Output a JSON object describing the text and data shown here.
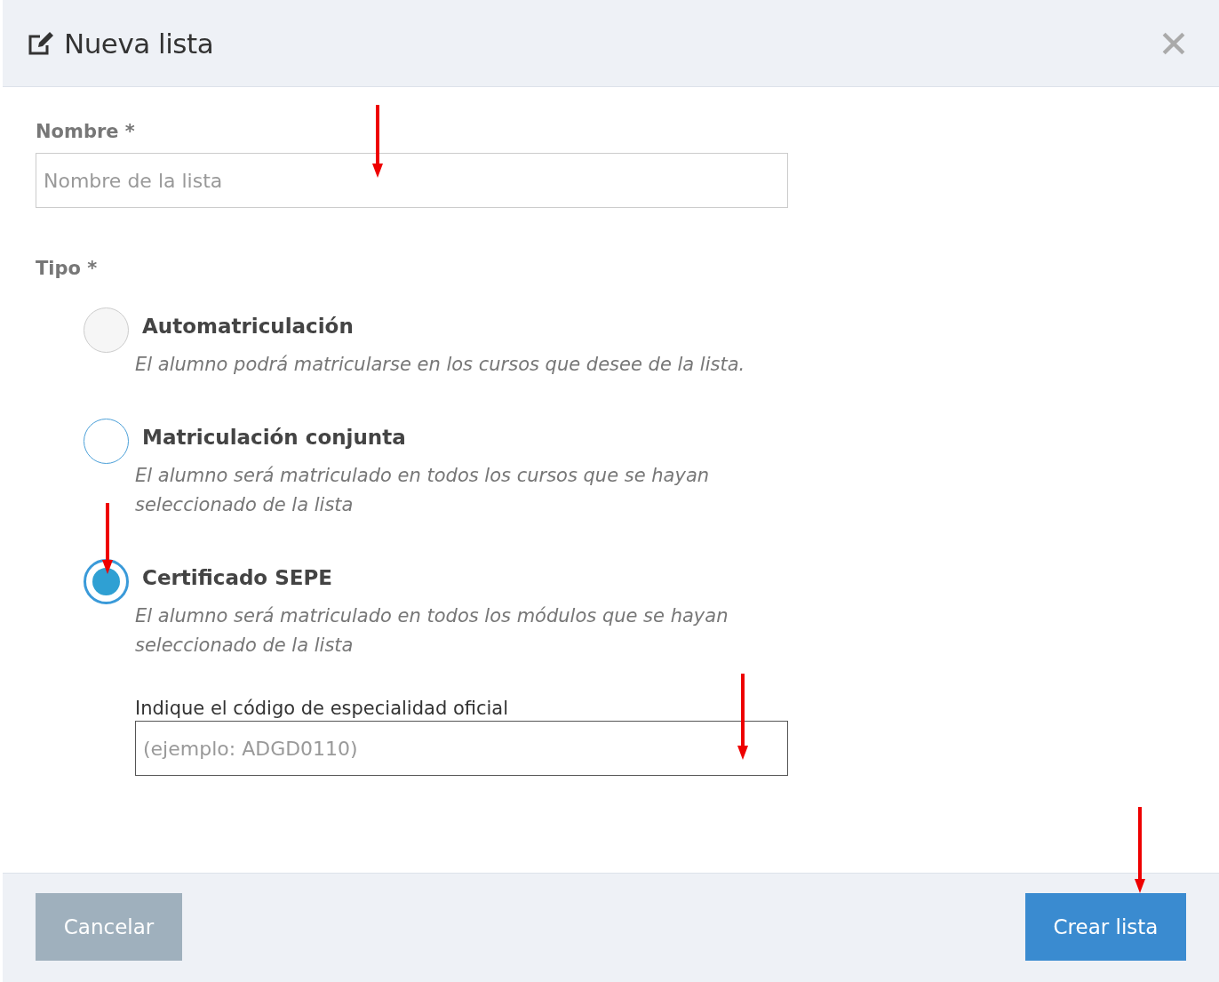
{
  "dialog": {
    "title": "Nueva lista"
  },
  "name_field": {
    "label": "Nombre *",
    "placeholder": "Nombre de la lista"
  },
  "type_field": {
    "label": "Tipo *",
    "options": [
      {
        "title": "Automatriculación",
        "description": "El alumno podrá matricularse en los cursos que desee de la lista.",
        "selected": false,
        "focused": false
      },
      {
        "title": "Matriculación conjunta",
        "description": "El alumno será matriculado en todos los cursos que se hayan seleccionado de la lista",
        "selected": false,
        "focused": true
      },
      {
        "title": "Certificado SEPE",
        "description": "El alumno será matriculado en todos los módulos que se hayan seleccionado de la lista",
        "selected": true,
        "focused": false,
        "code_field": {
          "label": "Indique el código de especialidad oficial",
          "placeholder": "(ejemplo: ADGD0110)"
        }
      }
    ]
  },
  "buttons": [
    {
      "label": "Cancelar",
      "kind": "secondary",
      "disabled": true
    },
    {
      "label": "Crear lista",
      "kind": "primary",
      "disabled": false
    }
  ]
}
